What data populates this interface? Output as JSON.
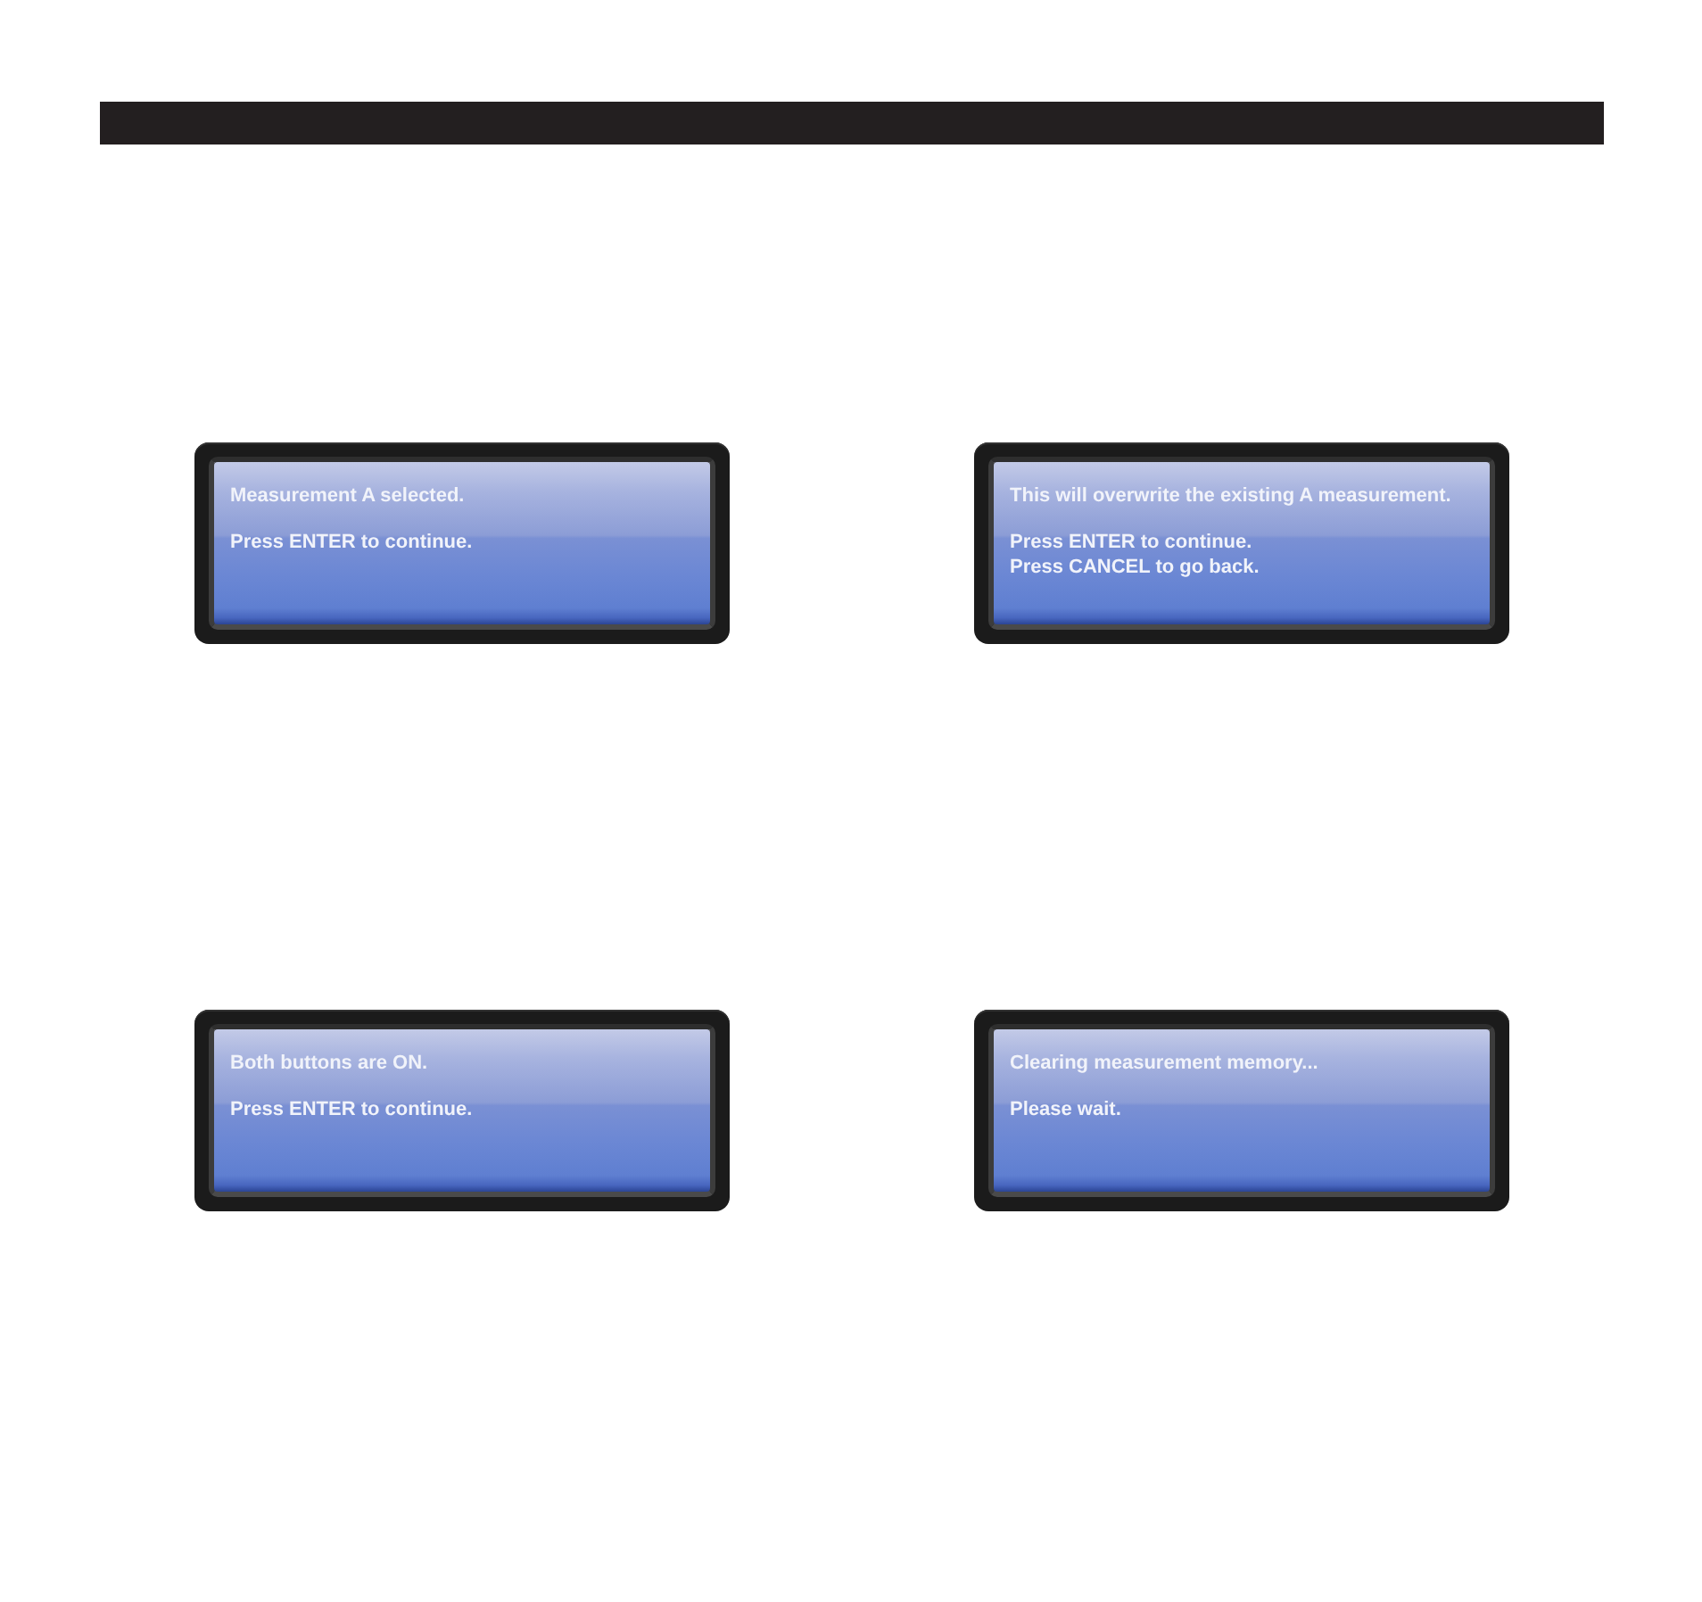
{
  "screens": [
    {
      "paragraphs": [
        [
          "Measurement A selected."
        ],
        [
          "Press ENTER to continue."
        ]
      ]
    },
    {
      "paragraphs": [
        [
          "This will overwrite the existing A measurement."
        ],
        [
          "Press ENTER to continue.",
          "Press CANCEL to go back."
        ]
      ]
    },
    {
      "paragraphs": [
        [
          "Both buttons are ON."
        ],
        [
          "Press ENTER to continue."
        ]
      ]
    },
    {
      "paragraphs": [
        [
          "Clearing measurement memory..."
        ],
        [
          "Please wait."
        ]
      ]
    }
  ]
}
